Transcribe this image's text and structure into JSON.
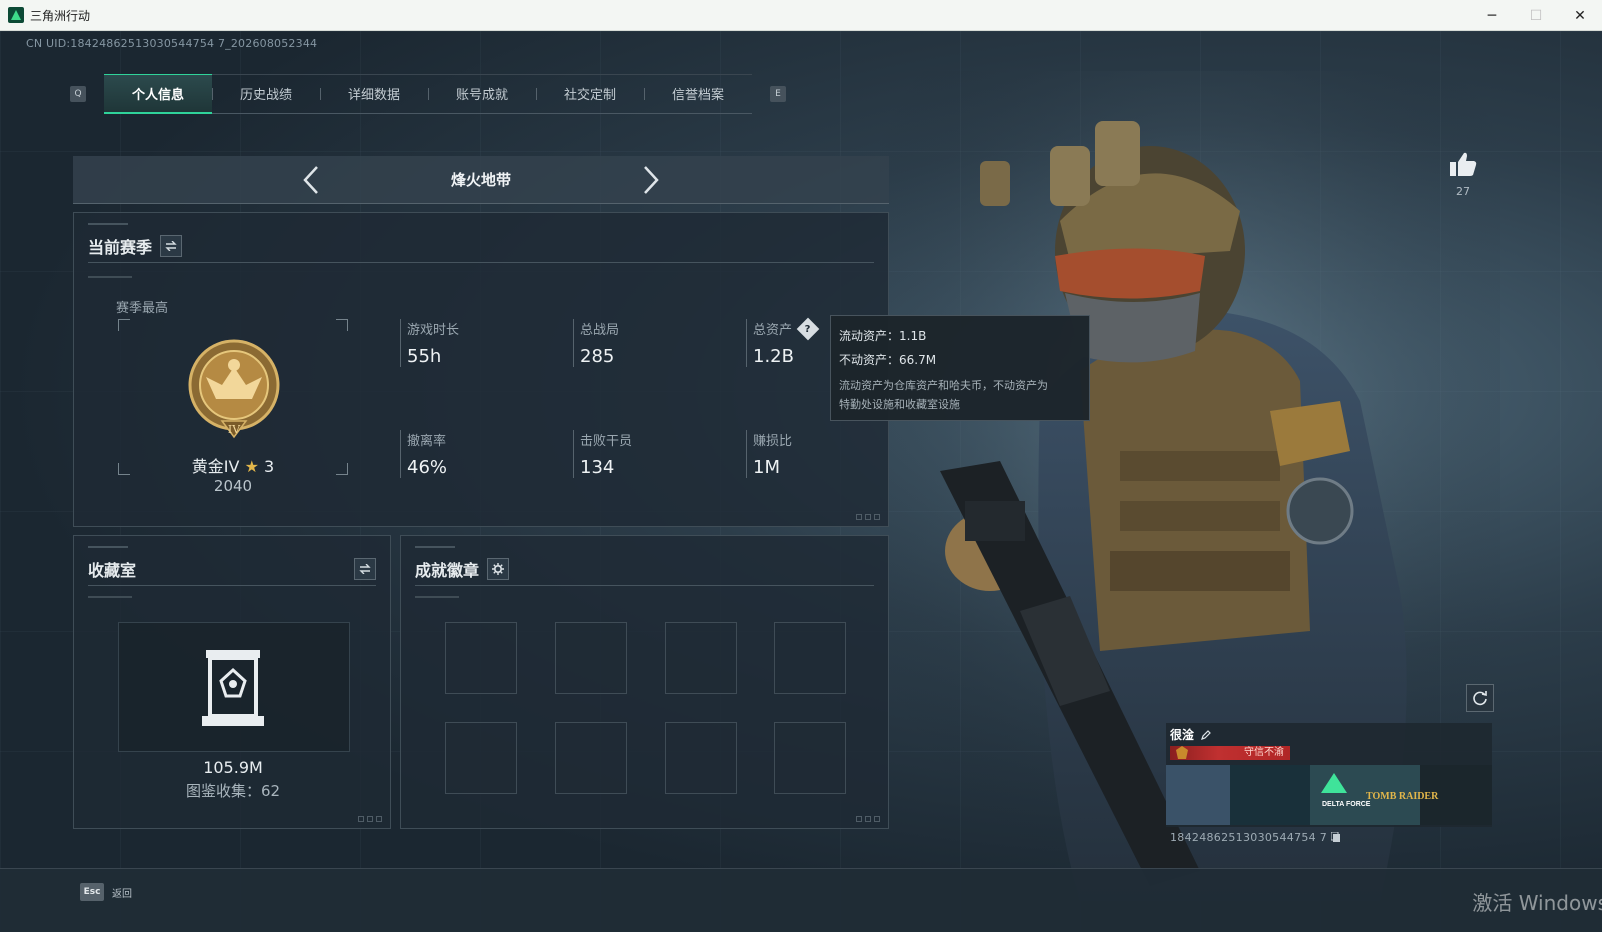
{
  "window": {
    "title": "三角洲行动",
    "minimize": "─",
    "maximize": "☐",
    "close": "✕"
  },
  "uid_line": "CN UID:18424862513030544754 7_202608052344",
  "tabs": {
    "key_left": "Q",
    "key_right": "E",
    "items": [
      "个人信息",
      "历史战绩",
      "详细数据",
      "账号成就",
      "社交定制",
      "信誉档案"
    ],
    "active_index": 0
  },
  "mode": {
    "title": "烽火地带"
  },
  "current_season": {
    "title": "当前赛季",
    "season_best_label": "赛季最高",
    "rank_name": "黄金IV",
    "rank_star": "★",
    "rank_level": "3",
    "rank_points": "2040",
    "rank_roman": "IV",
    "stats": [
      {
        "label": "游戏时长",
        "value": "55h"
      },
      {
        "label": "总战局",
        "value": "285"
      },
      {
        "label": "总资产",
        "value": "1.2B",
        "help": "?"
      },
      {
        "label": "撤离率",
        "value": "46%"
      },
      {
        "label": "击败干员",
        "value": "134"
      },
      {
        "label": "赚损比",
        "value": "1M"
      }
    ]
  },
  "tooltip": {
    "liquid": "流动资产：1.1B",
    "fixed": "不动资产：66.7M",
    "desc_1": "流动资产为仓库资产和哈夫币，不动资产为",
    "desc_2": "特勤处设施和收藏室设施"
  },
  "collection": {
    "title": "收藏室",
    "value": "105.9M",
    "count": "图鉴收集：62"
  },
  "badges": {
    "title": "成就徽章",
    "slot_count": 8
  },
  "profile": {
    "like_count": "27",
    "name": "很淦",
    "tag": "守信不渝",
    "banner_text_1": "DELTA FORCE",
    "banner_text_2": "TOMB RAIDER",
    "uid": "18424862513030544754 7"
  },
  "bottom": {
    "esc_key": "Esc",
    "esc_label": "返回",
    "activate": "激活 Windows"
  },
  "colors": {
    "accent": "#2fd39a",
    "gold": "#c9a24a",
    "tag_red": "#c03030"
  }
}
